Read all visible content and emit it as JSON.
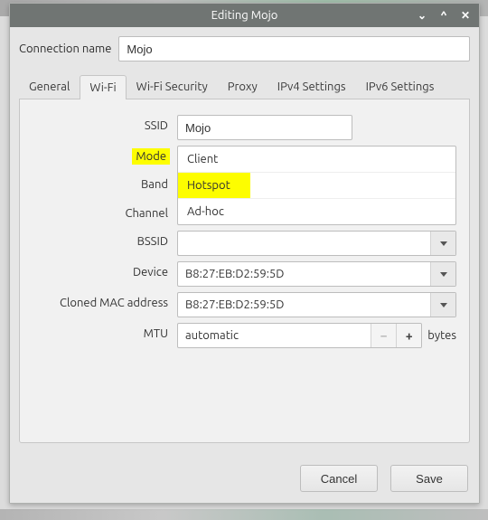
{
  "window": {
    "title": "Editing Mojo"
  },
  "connection_name": {
    "label": "Connection name",
    "value": "Mojo"
  },
  "tabs": [
    {
      "label": "General"
    },
    {
      "label": "Wi-Fi"
    },
    {
      "label": "Wi-Fi Security"
    },
    {
      "label": "Proxy"
    },
    {
      "label": "IPv4 Settings"
    },
    {
      "label": "IPv6 Settings"
    }
  ],
  "active_tab": "Wi-Fi",
  "wifi": {
    "ssid": {
      "label": "SSID",
      "value": "Mojo"
    },
    "mode": {
      "label": "Mode",
      "options": [
        "Client",
        "Hotspot",
        "Ad-hoc"
      ],
      "selected": "Client"
    },
    "band": {
      "label": "Band"
    },
    "channel": {
      "label": "Channel"
    },
    "bssid": {
      "label": "BSSID",
      "value": ""
    },
    "device": {
      "label": "Device",
      "value": "B8:27:EB:D2:59:5D"
    },
    "cloned_mac": {
      "label": "Cloned MAC address",
      "value": "B8:27:EB:D2:59:5D"
    },
    "mtu": {
      "label": "MTU",
      "value": "automatic",
      "unit": "bytes"
    }
  },
  "buttons": {
    "cancel": "Cancel",
    "save": "Save"
  },
  "highlights": {
    "mode_label": true,
    "hotspot_option": true
  }
}
